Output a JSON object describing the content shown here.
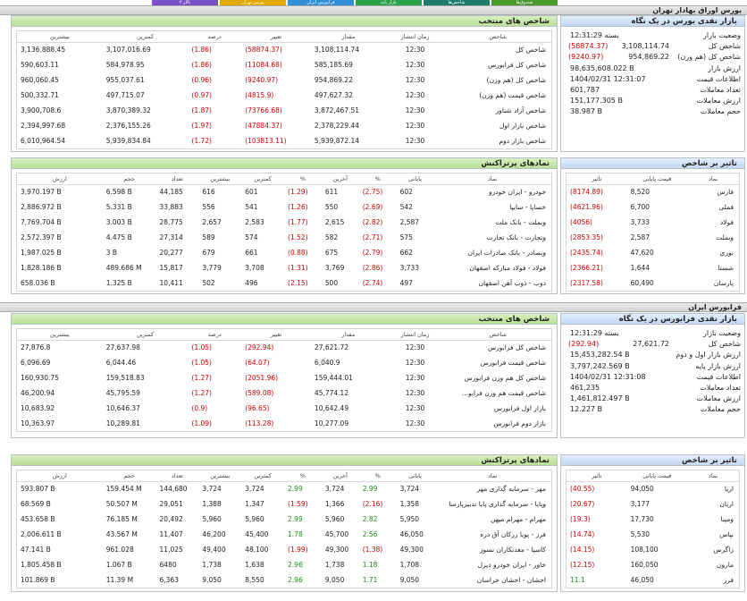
{
  "tabs": [
    "تالار ۳",
    "بورس تهران",
    "فرابورس ایران",
    "بازار پایه",
    "شاخص‌ها",
    "صندوق‌ها"
  ],
  "tab_colors": [
    "#7b4fc9",
    "#e0a800",
    "#2f8fd8",
    "#2aa34a",
    "#1e7c6a",
    "#4a9a2e"
  ],
  "tse": {
    "section_title": "بورس اوراق بهادار تهران",
    "overview": {
      "title": "بازار نقدی بورس در یک نگاه",
      "rows": [
        {
          "label": "وضعیت بازار",
          "value": "بسته 12:31:29",
          "change": ""
        },
        {
          "label": "شاخص کل",
          "value": "3,108,114.74",
          "change": "(58874.37)"
        },
        {
          "label": "شاخص کل (هم وزن)",
          "value": "954,869.22",
          "change": "(9240.97)"
        },
        {
          "label": "ارزش بازار",
          "value": "98,635,608.022 B",
          "change": ""
        },
        {
          "label": "اطلاعات قیمت",
          "value": "1404/02/31 12:31:07",
          "change": ""
        },
        {
          "label": "تعداد معاملات",
          "value": "601,787",
          "change": ""
        },
        {
          "label": "ارزش معاملات",
          "value": "151,177.305 B",
          "change": ""
        },
        {
          "label": "حجم معاملات",
          "value": "38.987 B",
          "change": ""
        }
      ]
    },
    "indices": {
      "title": "شاخص های منتخب",
      "headers": [
        "شاخص",
        "زمان انتشار",
        "مقدار",
        "تغییر",
        "درصد",
        "کمترین",
        "بیشترین"
      ],
      "rows": [
        [
          "شاخص کل",
          "12:30",
          "3,108,114.74",
          "(58874.37)",
          "(1.86)",
          "3,107,016.69",
          "3,136,888.45"
        ],
        [
          "شاخص کل فرابورس",
          "12:30",
          "585,185.69",
          "(11084.68)",
          "(1.86)",
          "584,978.95",
          "590,603.11"
        ],
        [
          "شاخص کل (هم وزن)",
          "12:30",
          "954,869.22",
          "(9240.97)",
          "(0.96)",
          "955,037.61",
          "960,060.45"
        ],
        [
          "شاخص قیمت (هم وزن)",
          "12:30",
          "497,627.32",
          "(4815.9)",
          "(0.97)",
          "497,715.07",
          "500,332.71"
        ],
        [
          "شاخص آزاد شناور",
          "12:30",
          "3,872,467.51",
          "(73766.68)",
          "(1.87)",
          "3,870,389.32",
          "3,900,708.6"
        ],
        [
          "شاخص بازار اول",
          "12:30",
          "2,378,229.44",
          "(47884.37)",
          "(1.97)",
          "2,376,155.26",
          "2,394,997.68"
        ],
        [
          "شاخص بازار دوم",
          "12:30",
          "5,939,872.14",
          "(103813.11)",
          "(1.72)",
          "5,939,834.84",
          "6,010,964.54"
        ]
      ]
    },
    "impact": {
      "title": "تاثیر بر شاخص",
      "headers": [
        "نماد",
        "قیمت پایانی",
        "تاثیر"
      ],
      "rows": [
        [
          "فارس",
          "8,520",
          "(8174.89)"
        ],
        [
          "فملی",
          "6,700",
          "(4621.96)"
        ],
        [
          "فولاد",
          "3,733",
          "(4056)"
        ],
        [
          "وبملت",
          "2,587",
          "(2853.35)"
        ],
        [
          "نوری",
          "47,620",
          "(2435.74)"
        ],
        [
          "شستا",
          "1,644",
          "(2366.21)"
        ],
        [
          "پارسان",
          "60,490",
          "(2317.58)"
        ]
      ]
    },
    "symbols": {
      "title": "نمادهای پرتراکنش",
      "headers": [
        "نماد",
        "پایانی",
        "%",
        "آخرین",
        "%",
        "کمترین",
        "بیشترین",
        "تعداد",
        "حجم",
        "ارزش"
      ],
      "rows": [
        [
          "خودرو - ایران خودرو",
          "602",
          "(2.75)",
          "611",
          "(1.29)",
          "601",
          "616",
          "44,185",
          "6.598 B",
          "3,970.197 B"
        ],
        [
          "خساپا - سایپا",
          "542",
          "(2.69)",
          "550",
          "(1.26)",
          "541",
          "556",
          "33,883",
          "5.331 B",
          "2,886.972 B"
        ],
        [
          "وبملت - بانک ملت",
          "2,587",
          "(2.82)",
          "2,615",
          "(1.77)",
          "2,583",
          "2,657",
          "28,775",
          "3.003 B",
          "7,769.704 B"
        ],
        [
          "وتجارت - بانک تجارت",
          "575",
          "(2.71)",
          "582",
          "(1.52)",
          "574",
          "589",
          "27,314",
          "4.475 B",
          "2,572.397 B"
        ],
        [
          "وبصادر - بانک صادرات ایران",
          "662",
          "(2.79)",
          "675",
          "(0.88)",
          "661",
          "679",
          "20,277",
          "3 B",
          "1,987.025 B"
        ],
        [
          "فولاد - فولاد مبارکه اصفهان",
          "3,733",
          "(2.86)",
          "3,769",
          "(1.31)",
          "3,708",
          "3,779",
          "15,817",
          "489.686 M",
          "1,828.186 B"
        ],
        [
          "ذوب - ذوب آهن اصفهان",
          "497",
          "(2.74)",
          "500",
          "(2.15)",
          "496",
          "502",
          "10,411",
          "1.325 B",
          "658.036 B"
        ]
      ]
    }
  },
  "ifb": {
    "section_title": "فرابورس ایران",
    "overview": {
      "title": "بازار نقدی فرابورس در یک نگاه",
      "rows": [
        {
          "label": "وضعیت بازار",
          "value": "بسته 12:31:29",
          "change": ""
        },
        {
          "label": "شاخص کل",
          "value": "27,621.72",
          "change": "(292.94)"
        },
        {
          "label": "ارزش بازار اول و دوم",
          "value": "15,453,282.54 B",
          "change": ""
        },
        {
          "label": "ارزش بازار پایه",
          "value": "3,797,242.569 B",
          "change": ""
        },
        {
          "label": "اطلاعات قیمت",
          "value": "1404/02/31 12:31:08",
          "change": ""
        },
        {
          "label": "تعداد معاملات",
          "value": "461,235",
          "change": ""
        },
        {
          "label": "ارزش معاملات",
          "value": "1,461,812.497 B",
          "change": ""
        },
        {
          "label": "حجم معاملات",
          "value": "12.227 B",
          "change": ""
        }
      ]
    },
    "indices": {
      "title": "شاخص های منتخب",
      "headers": [
        "شاخص",
        "زمان انتشار",
        "مقدار",
        "تغییر",
        "درصد",
        "کمترین",
        "بیشترین"
      ],
      "rows": [
        [
          "شاخص کل فرابورس",
          "12:30",
          "27,621.72",
          "(292.94)",
          "(1.05)",
          "27,637.98",
          "27,876.8"
        ],
        [
          "شاخص قیمت فرابورس",
          "12:30",
          "6,040.9",
          "(64.07)",
          "(1.05)",
          "6,044.46",
          "6,096.69"
        ],
        [
          "شاخص کل هم وزن فرابورس",
          "12:30",
          "159,444.01",
          "(2051.96)",
          "(1.27)",
          "159,518.83",
          "160,930.75"
        ],
        [
          "شاخص قیمت هم وزن فرابو...",
          "12:30",
          "45,774.12",
          "(589.08)",
          "(1.27)",
          "45,795.59",
          "46,200.94"
        ],
        [
          "بازار اول فرابورس",
          "12:30",
          "10,642.49",
          "(96.65)",
          "(0.9)",
          "10,646.37",
          "10,683.92"
        ],
        [
          "بازار دوم فرابورس",
          "12:30",
          "10,277.09",
          "(113.28)",
          "(1.09)",
          "10,289.81",
          "10,363.97"
        ]
      ]
    },
    "impact": {
      "title": "تاثیر بر شاخص",
      "headers": [
        "نماد",
        "قیمت پایانی",
        "تاثیر"
      ],
      "rows": [
        [
          "اریا",
          "94,050",
          "(40.55)"
        ],
        [
          "اریان",
          "3,177",
          "(20.67)"
        ],
        [
          "ومپنا",
          "17,730",
          "(19.3)"
        ],
        [
          "بپاس",
          "5,530",
          "(14.74)"
        ],
        [
          "زاگرس",
          "108,100",
          "(14.15)"
        ],
        [
          "مارون",
          "160,050",
          "(12.15)"
        ],
        [
          "فرز",
          "46,050",
          "11.1"
        ]
      ]
    },
    "symbols": {
      "title": "نمادهای پرتراکنش",
      "headers": [
        "نماد",
        "پایانی",
        "%",
        "آخرین",
        "%",
        "کمترین",
        "بیشترین",
        "تعداد",
        "حجم",
        "ارزش"
      ],
      "rows": [
        [
          "مهر - سرمایه گذاری مهر",
          "3,724",
          "2.99",
          "3,724",
          "2.99",
          "3,724",
          "3,724",
          "144,680",
          "159.454 M",
          "593.807 B"
        ],
        [
          "وپایا - سرمایه گذاری پایا تدبیرپارسا",
          "1,358",
          "(2.16)",
          "1,366",
          "(1.59)",
          "1,347",
          "1,388",
          "29,051",
          "50.507 M",
          "68.569 B"
        ],
        [
          "مهرام - مهرام میهن",
          "5,950",
          "2.82",
          "5,960",
          "2.99",
          "5,960",
          "5,960",
          "20,492",
          "76.185 M",
          "453.658 B"
        ],
        [
          "فرز - پویا زرکان آق دره",
          "46,050",
          "2.56",
          "45,700",
          "1.78",
          "45,400",
          "46,200",
          "11,407",
          "43.567 M",
          "2,006.611 B"
        ],
        [
          "کاسپا - معدنکاران نسوز",
          "49,300",
          "(1.38)",
          "49,300",
          "(1.99)",
          "48,100",
          "49,400",
          "11,025",
          "961.028",
          "47.141 B"
        ],
        [
          "خاور - ایران خودرو دیزل",
          "1,708",
          "1.18",
          "1,738",
          "2.96",
          "1,638",
          "1,738",
          "6480",
          "1.067 B",
          "1,805.458 B"
        ],
        [
          "اخشان - اخشان خراسان",
          "9,050",
          "1.71",
          "9,050",
          "2.96",
          "8,550",
          "9,050",
          "6,363",
          "11.39 M",
          "101.869 B"
        ]
      ]
    }
  }
}
